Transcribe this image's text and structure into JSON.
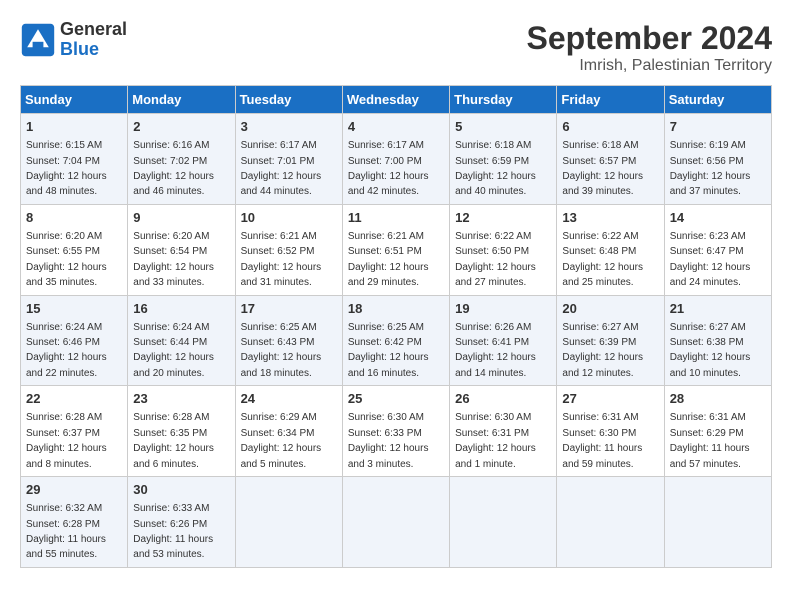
{
  "logo": {
    "line1": "General",
    "line2": "Blue"
  },
  "title": "September 2024",
  "subtitle": "Imrish, Palestinian Territory",
  "days_of_week": [
    "Sunday",
    "Monday",
    "Tuesday",
    "Wednesday",
    "Thursday",
    "Friday",
    "Saturday"
  ],
  "weeks": [
    [
      {
        "day": "1",
        "sunrise": "6:15 AM",
        "sunset": "7:04 PM",
        "daylight": "12 hours and 48 minutes."
      },
      {
        "day": "2",
        "sunrise": "6:16 AM",
        "sunset": "7:02 PM",
        "daylight": "12 hours and 46 minutes."
      },
      {
        "day": "3",
        "sunrise": "6:17 AM",
        "sunset": "7:01 PM",
        "daylight": "12 hours and 44 minutes."
      },
      {
        "day": "4",
        "sunrise": "6:17 AM",
        "sunset": "7:00 PM",
        "daylight": "12 hours and 42 minutes."
      },
      {
        "day": "5",
        "sunrise": "6:18 AM",
        "sunset": "6:59 PM",
        "daylight": "12 hours and 40 minutes."
      },
      {
        "day": "6",
        "sunrise": "6:18 AM",
        "sunset": "6:57 PM",
        "daylight": "12 hours and 39 minutes."
      },
      {
        "day": "7",
        "sunrise": "6:19 AM",
        "sunset": "6:56 PM",
        "daylight": "12 hours and 37 minutes."
      }
    ],
    [
      {
        "day": "8",
        "sunrise": "6:20 AM",
        "sunset": "6:55 PM",
        "daylight": "12 hours and 35 minutes."
      },
      {
        "day": "9",
        "sunrise": "6:20 AM",
        "sunset": "6:54 PM",
        "daylight": "12 hours and 33 minutes."
      },
      {
        "day": "10",
        "sunrise": "6:21 AM",
        "sunset": "6:52 PM",
        "daylight": "12 hours and 31 minutes."
      },
      {
        "day": "11",
        "sunrise": "6:21 AM",
        "sunset": "6:51 PM",
        "daylight": "12 hours and 29 minutes."
      },
      {
        "day": "12",
        "sunrise": "6:22 AM",
        "sunset": "6:50 PM",
        "daylight": "12 hours and 27 minutes."
      },
      {
        "day": "13",
        "sunrise": "6:22 AM",
        "sunset": "6:48 PM",
        "daylight": "12 hours and 25 minutes."
      },
      {
        "day": "14",
        "sunrise": "6:23 AM",
        "sunset": "6:47 PM",
        "daylight": "12 hours and 24 minutes."
      }
    ],
    [
      {
        "day": "15",
        "sunrise": "6:24 AM",
        "sunset": "6:46 PM",
        "daylight": "12 hours and 22 minutes."
      },
      {
        "day": "16",
        "sunrise": "6:24 AM",
        "sunset": "6:44 PM",
        "daylight": "12 hours and 20 minutes."
      },
      {
        "day": "17",
        "sunrise": "6:25 AM",
        "sunset": "6:43 PM",
        "daylight": "12 hours and 18 minutes."
      },
      {
        "day": "18",
        "sunrise": "6:25 AM",
        "sunset": "6:42 PM",
        "daylight": "12 hours and 16 minutes."
      },
      {
        "day": "19",
        "sunrise": "6:26 AM",
        "sunset": "6:41 PM",
        "daylight": "12 hours and 14 minutes."
      },
      {
        "day": "20",
        "sunrise": "6:27 AM",
        "sunset": "6:39 PM",
        "daylight": "12 hours and 12 minutes."
      },
      {
        "day": "21",
        "sunrise": "6:27 AM",
        "sunset": "6:38 PM",
        "daylight": "12 hours and 10 minutes."
      }
    ],
    [
      {
        "day": "22",
        "sunrise": "6:28 AM",
        "sunset": "6:37 PM",
        "daylight": "12 hours and 8 minutes."
      },
      {
        "day": "23",
        "sunrise": "6:28 AM",
        "sunset": "6:35 PM",
        "daylight": "12 hours and 6 minutes."
      },
      {
        "day": "24",
        "sunrise": "6:29 AM",
        "sunset": "6:34 PM",
        "daylight": "12 hours and 5 minutes."
      },
      {
        "day": "25",
        "sunrise": "6:30 AM",
        "sunset": "6:33 PM",
        "daylight": "12 hours and 3 minutes."
      },
      {
        "day": "26",
        "sunrise": "6:30 AM",
        "sunset": "6:31 PM",
        "daylight": "12 hours and 1 minute."
      },
      {
        "day": "27",
        "sunrise": "6:31 AM",
        "sunset": "6:30 PM",
        "daylight": "11 hours and 59 minutes."
      },
      {
        "day": "28",
        "sunrise": "6:31 AM",
        "sunset": "6:29 PM",
        "daylight": "11 hours and 57 minutes."
      }
    ],
    [
      {
        "day": "29",
        "sunrise": "6:32 AM",
        "sunset": "6:28 PM",
        "daylight": "11 hours and 55 minutes."
      },
      {
        "day": "30",
        "sunrise": "6:33 AM",
        "sunset": "6:26 PM",
        "daylight": "11 hours and 53 minutes."
      },
      null,
      null,
      null,
      null,
      null
    ]
  ]
}
